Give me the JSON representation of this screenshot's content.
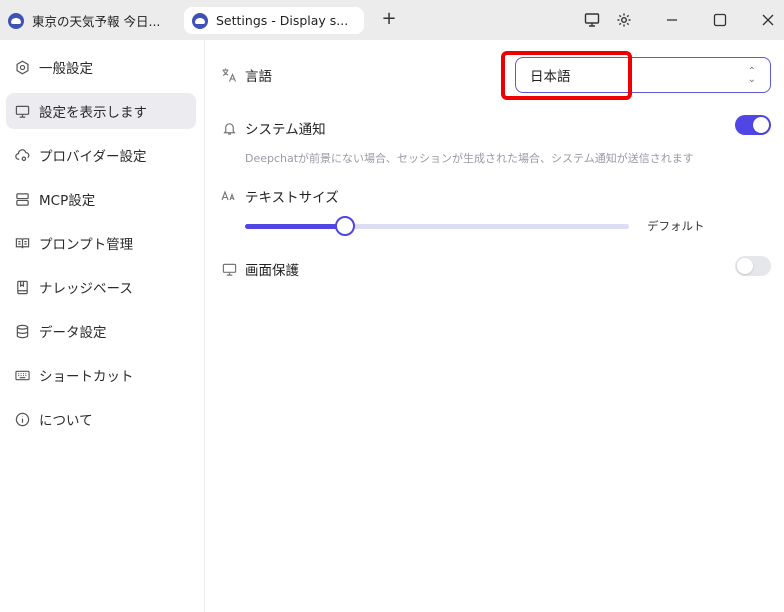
{
  "window": {
    "tabs": [
      {
        "label": "東京の天気予報 今日..."
      },
      {
        "label": "Settings - Display s..."
      }
    ],
    "new_tab": "+"
  },
  "sidebar": {
    "items": [
      {
        "label": "一般設定",
        "icon": "gear-hex-icon"
      },
      {
        "label": "設定を表示します",
        "icon": "monitor-icon",
        "active": true
      },
      {
        "label": "プロバイダー設定",
        "icon": "cloud-gear-icon"
      },
      {
        "label": "MCP設定",
        "icon": "server-icon"
      },
      {
        "label": "プロンプト管理",
        "icon": "book-icon"
      },
      {
        "label": "ナレッジベース",
        "icon": "notebook-icon"
      },
      {
        "label": "データ設定",
        "icon": "database-icon"
      },
      {
        "label": "ショートカット",
        "icon": "keyboard-icon"
      },
      {
        "label": "について",
        "icon": "info-icon"
      }
    ]
  },
  "main": {
    "language": {
      "label": "言語",
      "value": "日本語"
    },
    "notifications": {
      "label": "システム通知",
      "enabled": true,
      "description": "Deepchatが前景にない場合、セッションが生成された場合、システム通知が送信されます"
    },
    "text_size": {
      "label": "テキストサイズ",
      "value_label": "デフォルト",
      "level": 0.26
    },
    "screen_protection": {
      "label": "画面保護",
      "enabled": false
    }
  },
  "colors": {
    "accent": "#4f46e5",
    "highlight": "#ee0000"
  }
}
